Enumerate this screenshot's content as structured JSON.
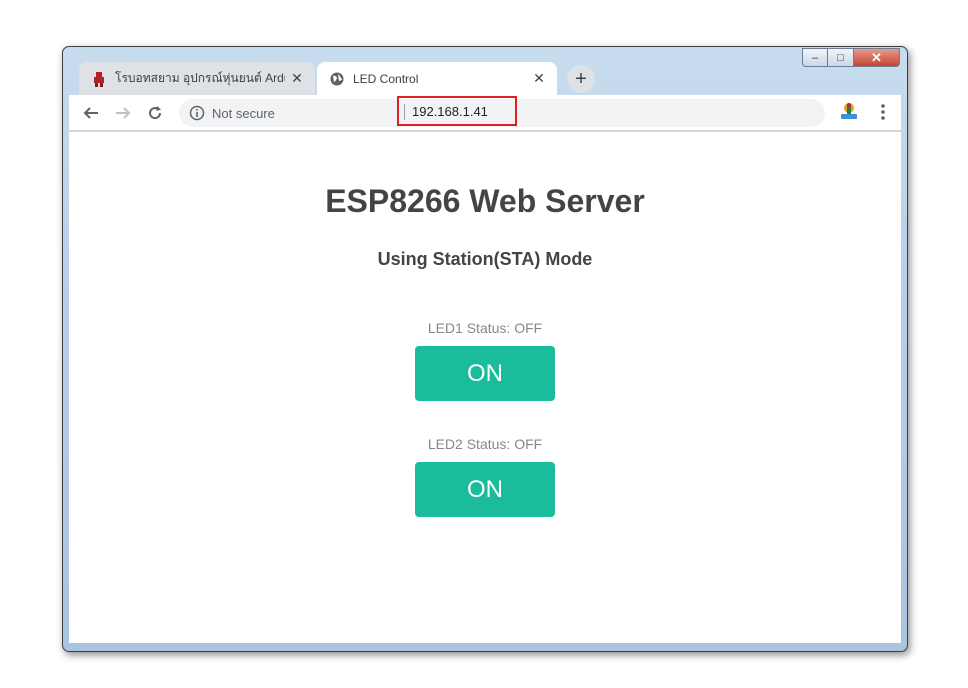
{
  "browser": {
    "tabs": [
      {
        "title": "โรบอทสยาม อุปกรณ์หุ่นยนต์ Arduino",
        "close": "✕",
        "active": false
      },
      {
        "title": "LED Control",
        "close": "✕",
        "active": true
      }
    ],
    "new_tab": "+",
    "security_label": "Not secure",
    "url": "192.168.1.41",
    "window_controls": {
      "minimize": "–",
      "maximize": "□",
      "close": "✕"
    }
  },
  "page": {
    "heading": "ESP8266 Web Server",
    "subheading": "Using Station(STA) Mode",
    "leds": [
      {
        "status": "LED1 Status: OFF",
        "button_label": "ON"
      },
      {
        "status": "LED2 Status: OFF",
        "button_label": "ON"
      }
    ]
  },
  "colors": {
    "button": "#1abc9c",
    "heading": "#444444",
    "status": "#888888",
    "url_highlight": "#e02020"
  }
}
